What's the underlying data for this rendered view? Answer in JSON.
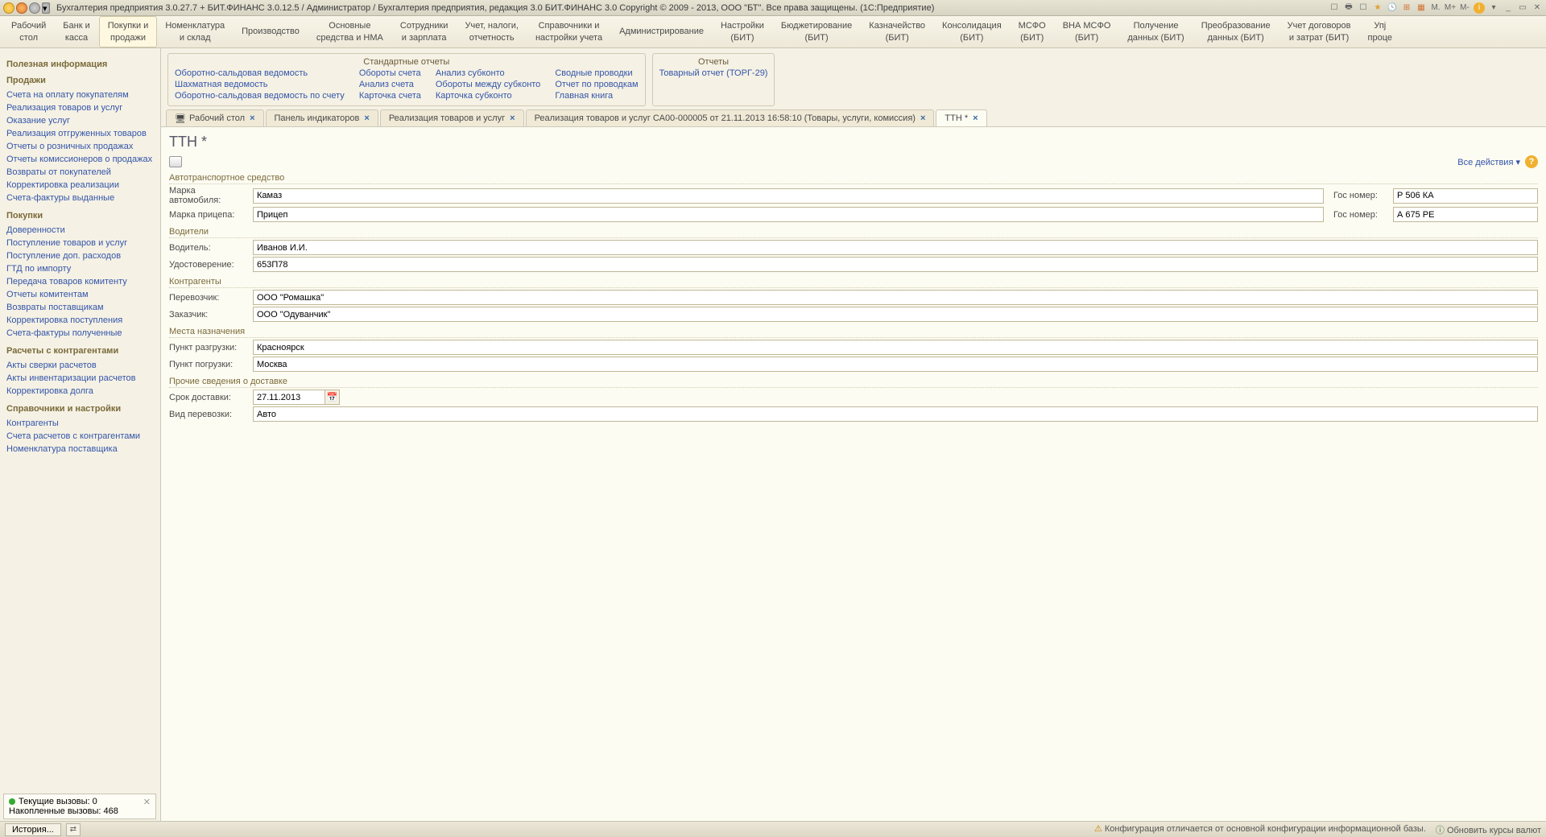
{
  "titlebar": {
    "text": "Бухгалтерия предприятия 3.0.27.7 + БИТ.ФИНАНС 3.0.12.5 / Администратор / Бухгалтерия предприятия, редакция 3.0  БИТ.ФИНАНС 3.0 Copyright © 2009 - 2013, ООО \"БТ\". Все права защищены.  (1С:Предприятие)",
    "right_labels": [
      "M.",
      "M+",
      "M-"
    ]
  },
  "main_menu": [
    "Рабочий\nстол",
    "Банк и\nкасса",
    "Покупки и\nпродажи",
    "Номенклатура\nи склад",
    "Производство",
    "Основные\nсредства и НМА",
    "Сотрудники\nи зарплата",
    "Учет, налоги,\nотчетность",
    "Справочники и\nнастройки учета",
    "Администрирование",
    "Настройки\n(БИТ)",
    "Бюджетирование\n(БИТ)",
    "Казначейство\n(БИТ)",
    "Консолидация\n(БИТ)",
    "МСФО\n(БИТ)",
    "ВНА МСФО\n(БИТ)",
    "Получение\nданных (БИТ)",
    "Преобразование\nданных (БИТ)",
    "Учет договоров\nи затрат (БИТ)",
    "Упј\nпроце"
  ],
  "main_menu_active": 2,
  "sidebar": {
    "sections": [
      {
        "title": "Полезная информация",
        "links": []
      },
      {
        "title": "Продажи",
        "links": [
          "Счета на оплату покупателям",
          "Реализация товаров и услуг",
          "Оказание услуг",
          "Реализация отгруженных товаров",
          "Отчеты о розничных продажах",
          "Отчеты комиссионеров о продажах",
          "Возвраты от покупателей",
          "Корректировка реализации",
          "Счета-фактуры выданные"
        ]
      },
      {
        "title": "Покупки",
        "links": [
          "Доверенности",
          "Поступление товаров и услуг",
          "Поступление доп. расходов",
          "ГТД по импорту",
          "Передача товаров комитенту",
          "Отчеты комитентам",
          "Возвраты поставщикам",
          "Корректировка поступления",
          "Счета-фактуры полученные"
        ]
      },
      {
        "title": "Расчеты с контрагентами",
        "links": [
          "Акты сверки расчетов",
          "Акты инвентаризации расчетов",
          "Корректировка долга"
        ]
      },
      {
        "title": "Справочники и настройки",
        "links": [
          "Контрагенты",
          "Счета расчетов с контрагентами",
          "Номенклатура поставщика"
        ]
      }
    ]
  },
  "calls_box": {
    "line1": "Текущие вызовы: 0",
    "line2": "Накопленные вызовы: 468"
  },
  "report_panels": {
    "standard": {
      "title": "Стандартные отчеты",
      "cols": [
        [
          "Оборотно-сальдовая ведомость",
          "Шахматная ведомость",
          "Оборотно-сальдовая ведомость по счету"
        ],
        [
          "Обороты счета",
          "Анализ счета",
          "Карточка счета"
        ],
        [
          "Анализ субконто",
          "Обороты между субконто",
          "Карточка субконто"
        ],
        [
          "Сводные проводки",
          "Отчет по проводкам",
          "Главная книга"
        ]
      ]
    },
    "reports": {
      "title": "Отчеты",
      "cols": [
        [
          "Товарный отчет (ТОРГ-29)"
        ]
      ]
    }
  },
  "tabs": [
    {
      "label": "Рабочий стол",
      "icon": true
    },
    {
      "label": "Панель индикаторов"
    },
    {
      "label": "Реализация товаров и услуг"
    },
    {
      "label": "Реализация товаров и услуг СА00-000005 от 21.11.2013 16:58:10 (Товары, услуги, комиссия)"
    },
    {
      "label": "ТТН *",
      "active": true
    }
  ],
  "form": {
    "title": "ТТН *",
    "all_actions": "Все действия ▾",
    "sections": {
      "vehicle": {
        "title": "Автотранспортное средство",
        "car_brand_label": "Марка автомобиля:",
        "car_brand": "Камаз",
        "gos1_label": "Гос номер:",
        "gos1": "Р 506 КА",
        "trailer_label": "Марка прицепа:",
        "trailer": "Прицеп",
        "gos2_label": "Гос номер:",
        "gos2": "А 675 РЕ"
      },
      "drivers": {
        "title": "Водители",
        "driver_label": "Водитель:",
        "driver": "Иванов И.И.",
        "license_label": "Удостоверение:",
        "license": "653П78"
      },
      "counterparties": {
        "title": "Контрагенты",
        "carrier_label": "Перевозчик:",
        "carrier": "ООО \"Ромашка\"",
        "customer_label": "Заказчик:",
        "customer": "ООО \"Одуванчик\""
      },
      "destinations": {
        "title": "Места назначения",
        "unload_label": "Пункт разгрузки:",
        "unload": "Красноярск",
        "load_label": "Пункт погрузки:",
        "load": "Москва"
      },
      "other": {
        "title": "Прочие сведения о доставке",
        "deadline_label": "Срок доставки:",
        "deadline": "27.11.2013",
        "type_label": "Вид перевозки:",
        "type": "Авто"
      }
    }
  },
  "statusbar": {
    "history": "История...",
    "warn": "Конфигурация отличается от основной конфигурации информационной базы.",
    "update": "Обновить курсы валют"
  }
}
